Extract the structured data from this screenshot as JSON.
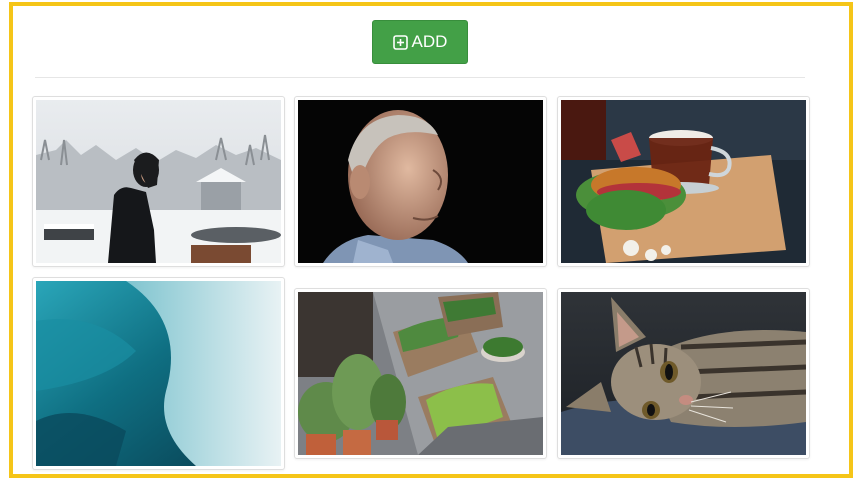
{
  "toolbar": {
    "add_label": "ADD",
    "add_icon": "plus-square-icon",
    "accent_color": "#43a047",
    "frame_color": "#f5c518"
  },
  "gallery": {
    "items": [
      {
        "name": "woman-in-snow-photo"
      },
      {
        "name": "elderly-man-portrait-photo"
      },
      {
        "name": "sandwich-and-tea-photo"
      },
      {
        "name": "ocean-wave-photo"
      },
      {
        "name": "potted-plants-photo"
      },
      {
        "name": "tabby-kitten-photo"
      }
    ]
  }
}
